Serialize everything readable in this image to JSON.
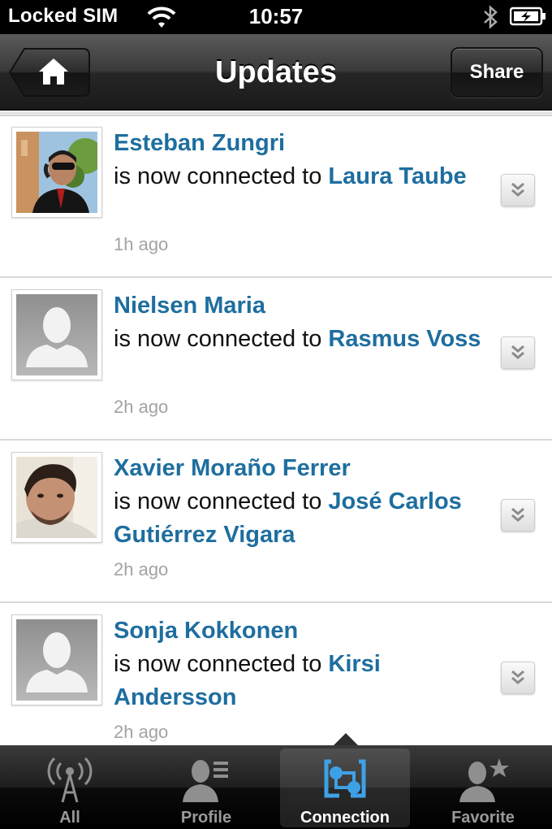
{
  "status_bar": {
    "carrier": "Locked SIM",
    "time": "10:57",
    "wifi_icon": "wifi-icon",
    "bluetooth_icon": "bluetooth-icon",
    "battery_icon": "battery-charging-icon"
  },
  "nav": {
    "title": "Updates",
    "home_icon": "home-icon",
    "share_label": "Share"
  },
  "feed": {
    "connector_text": "is now connected to",
    "items": [
      {
        "name": "Esteban Zungri",
        "target": "Laura Taube",
        "time": "1h ago",
        "avatar": "photo"
      },
      {
        "name": "Nielsen Maria",
        "target": "Rasmus Voss",
        "time": "2h ago",
        "avatar": "placeholder"
      },
      {
        "name": "Xavier Moraño Ferrer",
        "target": "José Carlos Gutiérrez Vigara",
        "time": "2h ago",
        "avatar": "photo"
      },
      {
        "name": "Sonja Kokkonen",
        "target": "Kirsi Andersson",
        "time": "2h ago",
        "avatar": "placeholder"
      }
    ]
  },
  "tabs": [
    {
      "label": "All",
      "icon": "antenna-icon",
      "active": false
    },
    {
      "label": "Profile",
      "icon": "profile-icon",
      "active": false
    },
    {
      "label": "Connection",
      "icon": "connection-icon",
      "active": true
    },
    {
      "label": "Favorite",
      "icon": "favorite-icon",
      "active": false
    }
  ],
  "colors": {
    "link": "#1e6e9f",
    "timestamp": "#a3a3a3",
    "active_tab_icon": "#3ea1e6"
  }
}
